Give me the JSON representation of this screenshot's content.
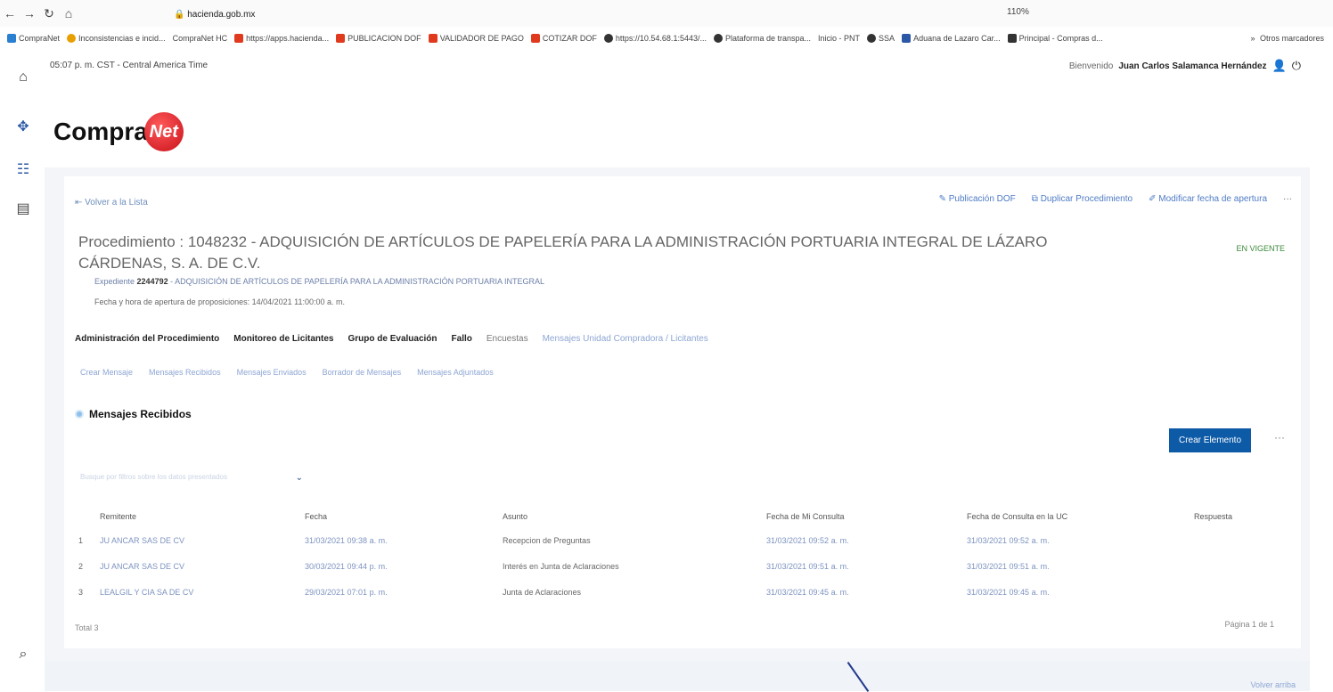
{
  "browser": {
    "url_host": "hacienda.gob.mx",
    "zoom": "110%",
    "bookmarks": [
      "CompraNet",
      "Inconsistencias e incid...",
      "CompraNet HC",
      "https://apps.hacienda...",
      "PUBLICACION DOF",
      "VALIDADOR DE PAGO",
      "COTIZAR DOF",
      "https://10.54.68.1:5443/...",
      "Plataforma de transpa...",
      "Inicio - PNT",
      "SSA",
      "Aduana de Lazaro Car...",
      "Principal - Compras d...",
      "Otros marcadores"
    ]
  },
  "topbar": {
    "time": "05:07 p. m. CST - Central America Time",
    "welcome_prefix": "Bienvenido",
    "user_name": "Juan Carlos Salamanca Hernández"
  },
  "logo": {
    "text": "Compra",
    "ball_text": "Net"
  },
  "card": {
    "back_link": "Volver a la Lista",
    "actions": [
      "Publicación DOF",
      "Duplicar Procedimiento",
      "Modificar fecha de apertura"
    ],
    "title": "Procedimiento : 1048232 - ADQUISICIÓN DE ARTÍCULOS DE PAPELERÍA PARA LA ADMINISTRACIÓN PORTUARIA INTEGRAL DE LÁZARO CÁRDENAS, S. A. DE C.V.",
    "status": "EN VIGENTE",
    "expediente_label": "Expediente ",
    "expediente_num": "2244792",
    "expediente_desc": " - ADQUISICIÓN DE ARTÍCULOS DE PAPELERÍA PARA LA ADMINISTRACIÓN PORTUARIA INTEGRAL",
    "fecha_apertura": "Fecha y hora de apertura de proposiciones: 14/04/2021 11:00:00 a. m.",
    "tabs1": [
      "Administración del Procedimiento",
      "Monitoreo de Licitantes",
      "Grupo de Evaluación",
      "Fallo",
      "Encuestas",
      "Mensajes Unidad Compradora / Licitantes"
    ],
    "tabs2": [
      "Crear Mensaje",
      "Mensajes Recibidos",
      "Mensajes Enviados",
      "Borrador de Mensajes",
      "Mensajes Adjuntados"
    ],
    "section_title": "Mensajes Recibidos",
    "crear_button": "Crear Elemento",
    "filter_placeholder": "Busque por filtros sobre los datos presentados"
  },
  "table": {
    "headers": [
      "",
      "Remitente",
      "Fecha",
      "Asunto",
      "Fecha de Mi Consulta",
      "Fecha de Consulta en la UC",
      "Respuesta"
    ],
    "rows": [
      [
        "1",
        "JU ANCAR SAS DE CV",
        "31/03/2021 09:38 a. m.",
        "Recepcion de Preguntas",
        "31/03/2021 09:52 a. m.",
        "31/03/2021 09:52 a. m.",
        ""
      ],
      [
        "2",
        "JU ANCAR SAS DE CV",
        "30/03/2021 09:44 p. m.",
        "Interés en Junta de Aclaraciones",
        "31/03/2021 09:51 a. m.",
        "31/03/2021 09:51 a. m.",
        ""
      ],
      [
        "3",
        "LEALGIL Y CIA SA DE CV",
        "29/03/2021 07:01 p. m.",
        "Junta de Aclaraciones",
        "31/03/2021 09:45 a. m.",
        "31/03/2021 09:45 a. m.",
        ""
      ]
    ],
    "total": "Total 3",
    "paging": "Página 1 de 1"
  },
  "footer": {
    "link": "Volver arriba"
  }
}
